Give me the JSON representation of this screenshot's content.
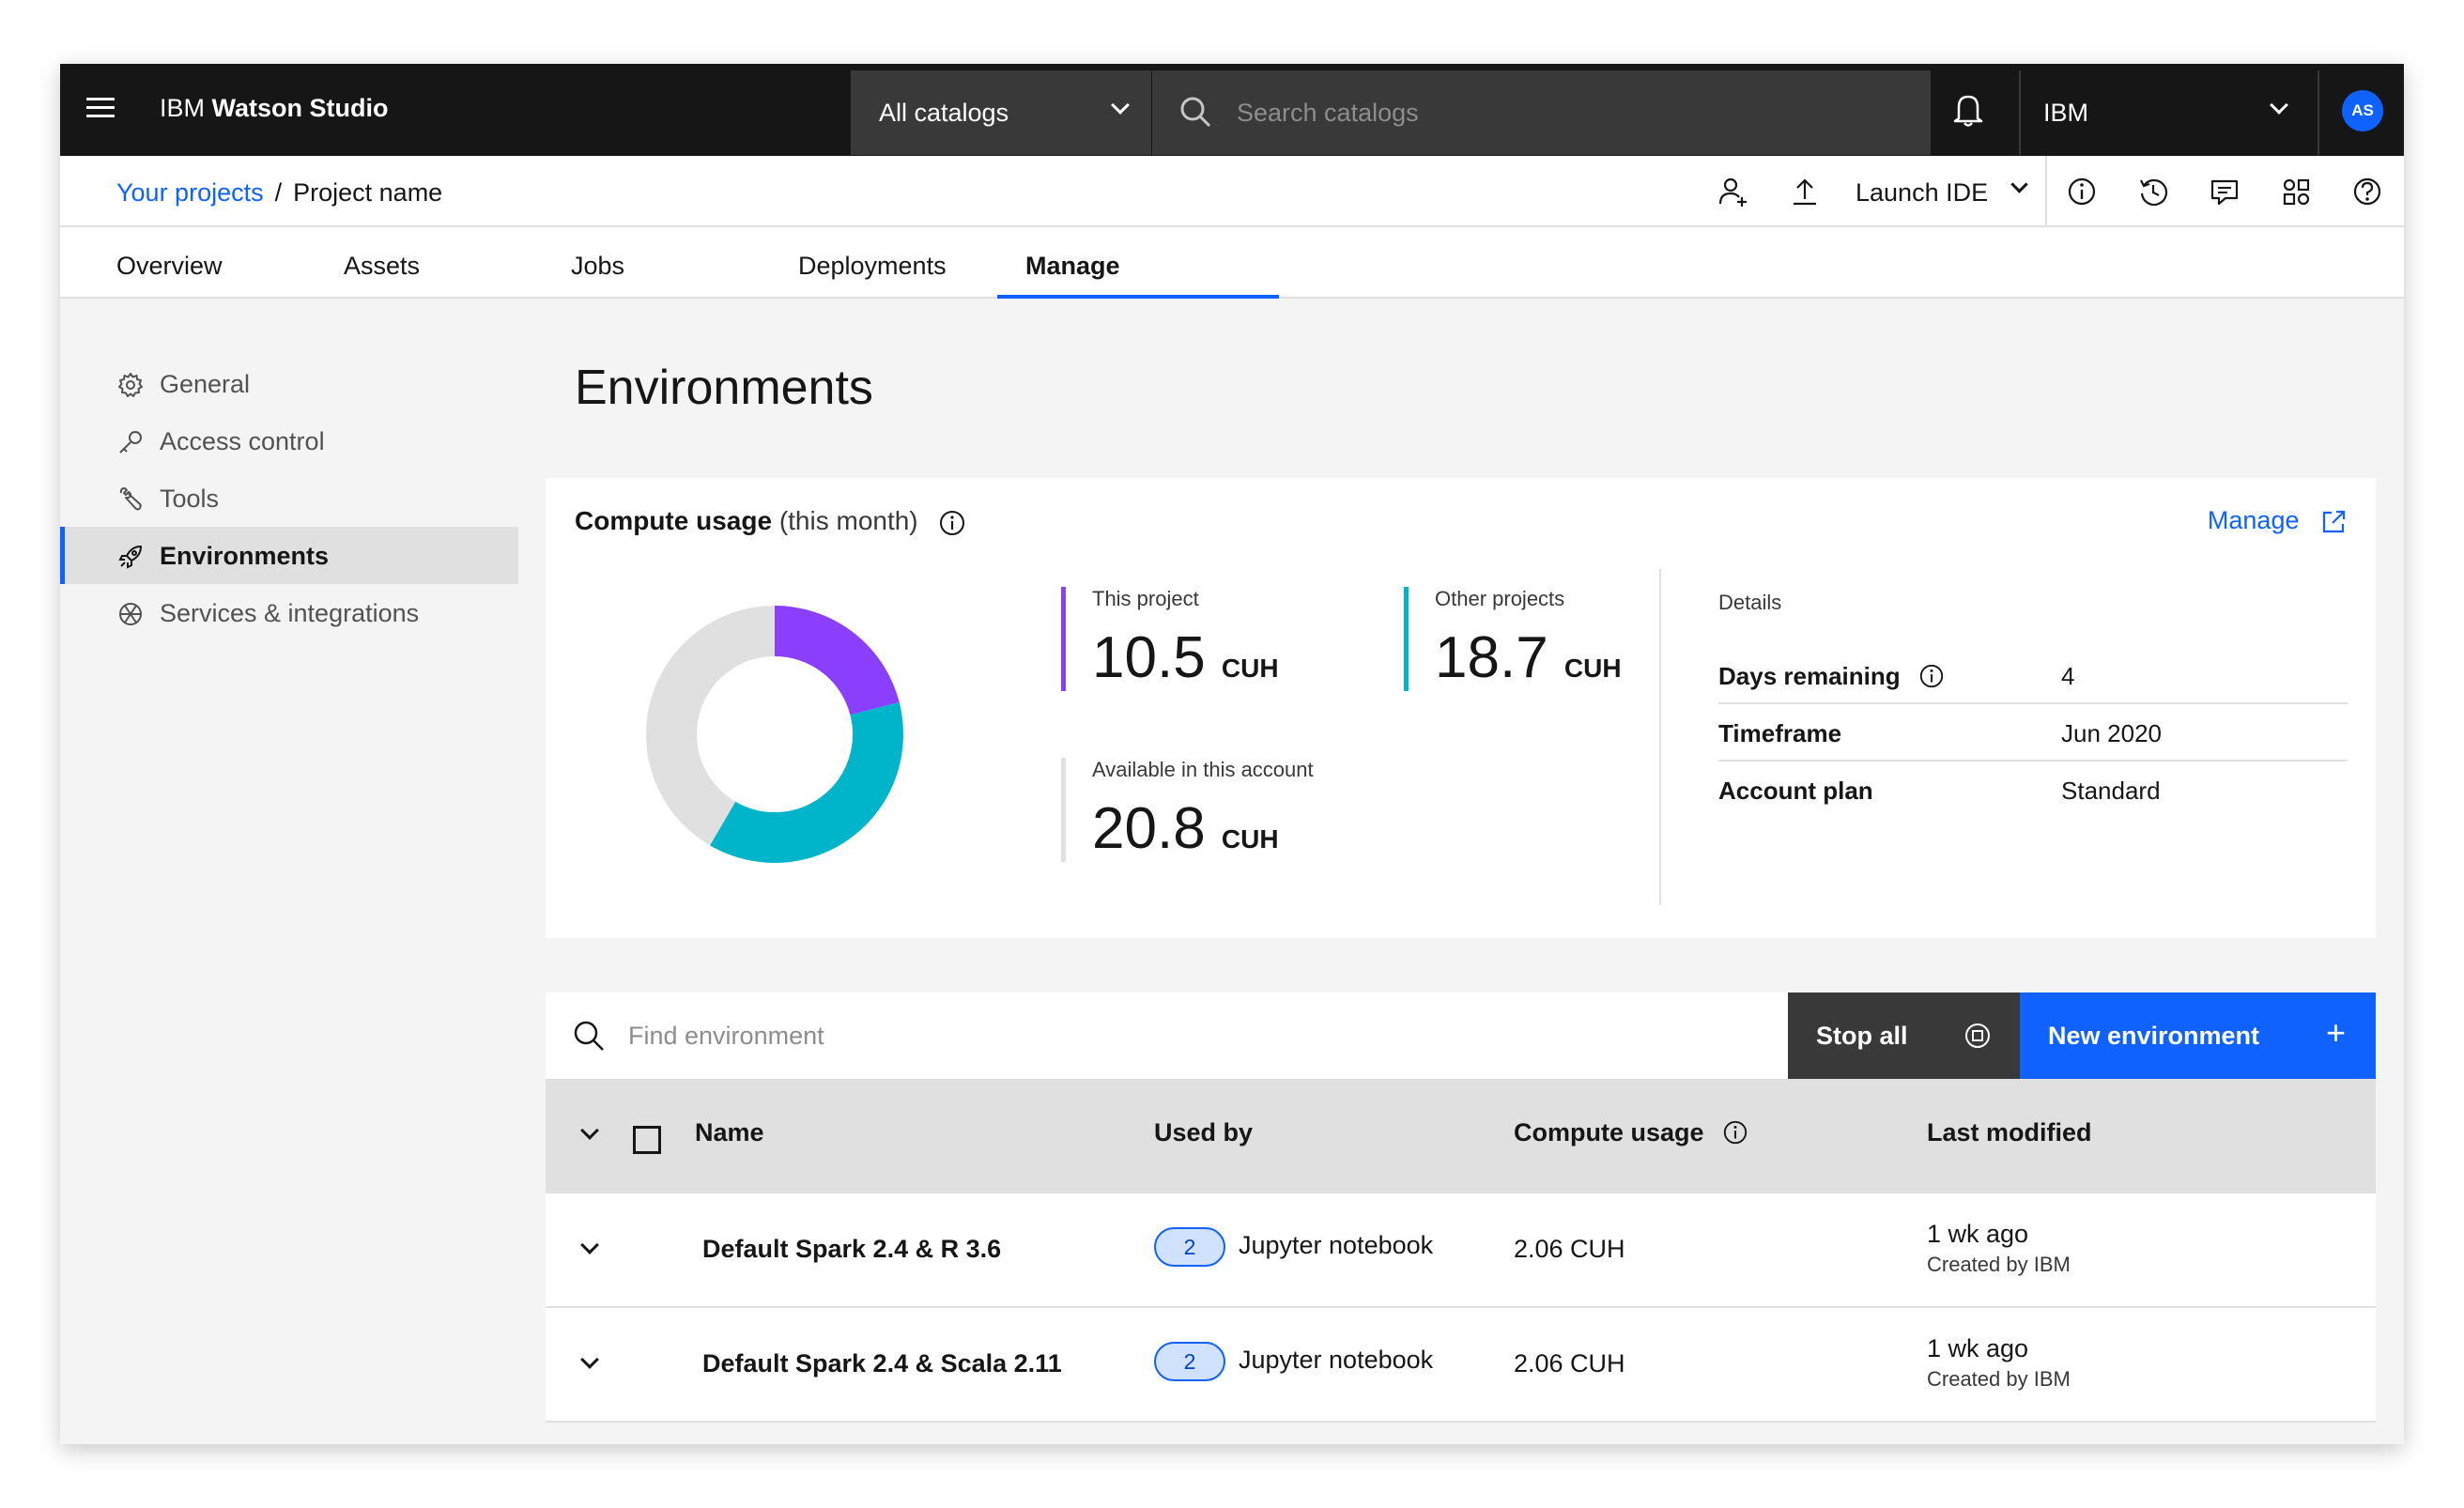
{
  "app": {
    "brand_prefix": "IBM",
    "brand_name": "Watson Studio"
  },
  "header": {
    "catalog_select": "All catalogs",
    "search_placeholder": "Search catalogs",
    "org_select": "IBM",
    "avatar_initials": "AS"
  },
  "breadcrumb": {
    "parent": "Your projects",
    "separator": "/",
    "current": "Project name"
  },
  "actions": {
    "launch_ide": "Launch IDE"
  },
  "tabs": [
    {
      "label": "Overview"
    },
    {
      "label": "Assets"
    },
    {
      "label": "Jobs"
    },
    {
      "label": "Deployments"
    },
    {
      "label": "Manage",
      "active": true
    }
  ],
  "sidebar": {
    "items": [
      {
        "label": "General",
        "icon": "gear-icon"
      },
      {
        "label": "Access control",
        "icon": "key-icon"
      },
      {
        "label": "Tools",
        "icon": "tools-icon"
      },
      {
        "label": "Environments",
        "icon": "rocket-icon",
        "active": true
      },
      {
        "label": "Services & integrations",
        "icon": "network-icon"
      }
    ]
  },
  "page": {
    "title": "Environments"
  },
  "usage": {
    "title": "Compute usage",
    "subtitle": "(this month)",
    "manage_label": "Manage",
    "stats": {
      "this_project": {
        "label": "This project",
        "value": "10.5",
        "unit": "CUH"
      },
      "other_projects": {
        "label": "Other projects",
        "value": "18.7",
        "unit": "CUH"
      },
      "available": {
        "label": "Available in this account",
        "value": "20.8",
        "unit": "CUH"
      }
    },
    "donut": {
      "segments": [
        {
          "value": 10.5,
          "color": "#8a3ffc"
        },
        {
          "value": 18.7,
          "color": "#00b4c9"
        },
        {
          "value": 20.8,
          "color": "#e0e0e0"
        }
      ]
    },
    "details": {
      "heading": "Details",
      "rows": [
        {
          "key": "Days remaining",
          "value": "4",
          "info": true
        },
        {
          "key": "Timeframe",
          "value": "Jun 2020"
        },
        {
          "key": "Account plan",
          "value": "Standard"
        }
      ]
    },
    "colors": {
      "this_project": "#8a3ffc",
      "other_projects": "#00b4c9",
      "available": "#e0e0e0"
    }
  },
  "toolbar": {
    "search_placeholder": "Find environment",
    "stop_all": "Stop all",
    "new_environment": "New environment"
  },
  "table": {
    "columns": {
      "name": "Name",
      "used_by": "Used by",
      "compute": "Compute usage",
      "modified": "Last modified"
    },
    "rows": [
      {
        "name": "Default Spark 2.4 & R 3.6",
        "count": "2",
        "used_by": "Jupyter notebook",
        "compute": "2.06 CUH",
        "modified": "1 wk ago",
        "created_by": "Created by IBM"
      },
      {
        "name": "Default Spark 2.4 & Scala 2.11",
        "count": "2",
        "used_by": "Jupyter notebook",
        "compute": "2.06 CUH",
        "modified": "1 wk ago",
        "created_by": "Created by IBM"
      }
    ]
  },
  "theme": {
    "accent": "#0f62fe",
    "header_bg": "#161616",
    "surface": "#f4f4f4"
  }
}
